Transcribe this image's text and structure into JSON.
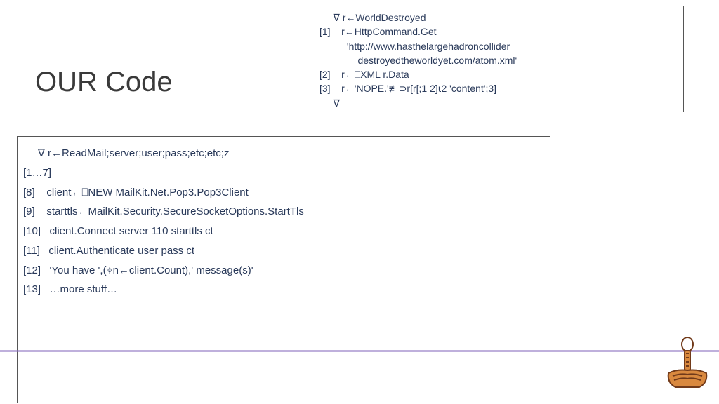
{
  "title": "OUR Code",
  "topbox": {
    "lines": [
      "     ∇ r←WorldDestroyed",
      "[1]    r←HttpCommand.Get",
      "          'http://www.hasthelargehadroncollider",
      "              destroyedtheworldyet.com/atom.xml'",
      "[2]    r←⎕XML r.Data",
      "[3]    r←'NOPE.'≢⊃r[r[;1 2]⍳2 'content';3]",
      "     ∇"
    ]
  },
  "mainbox": {
    "lines": [
      "     ∇ r←ReadMail;server;user;pass;etc;etc;z",
      "[1…7]",
      "[8]    client←⎕NEW MailKit.Net.Pop3.Pop3Client",
      "[9]    starttls←MailKit.Security.SecureSocketOptions.StartTls",
      "[10]   client.Connect server 110 starttls ct",
      "[11]   client.Authenticate user pass ct",
      "[12]   'You have ',(⍕n←client.Count),' message(s)'",
      "[13]   …more stuff…"
    ]
  }
}
